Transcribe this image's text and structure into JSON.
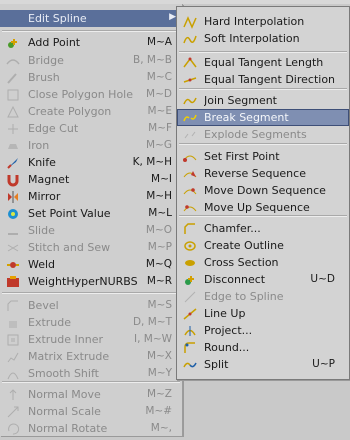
{
  "main_menu": {
    "header_label": "Edit Spline",
    "items": [
      {
        "label": "Add Point",
        "shortcut": "M~A",
        "icon": "add-point-icon",
        "enabled": true
      },
      {
        "label": "Bridge",
        "shortcut": "B, M~B",
        "icon": "bridge-icon",
        "enabled": false
      },
      {
        "label": "Brush",
        "shortcut": "M~C",
        "icon": "brush-icon",
        "enabled": false
      },
      {
        "label": "Close Polygon Hole",
        "shortcut": "M~D",
        "icon": "close-hole-icon",
        "enabled": false
      },
      {
        "label": "Create Polygon",
        "shortcut": "M~E",
        "icon": "create-polygon-icon",
        "enabled": false
      },
      {
        "label": "Edge Cut",
        "shortcut": "M~F",
        "icon": "edge-cut-icon",
        "enabled": false
      },
      {
        "label": "Iron",
        "shortcut": "M~G",
        "icon": "iron-icon",
        "enabled": false
      },
      {
        "label": "Knife",
        "shortcut": "K, M~H",
        "icon": "knife-icon",
        "enabled": true
      },
      {
        "label": "Magnet",
        "shortcut": "M~I",
        "icon": "magnet-icon",
        "enabled": true
      },
      {
        "label": "Mirror",
        "shortcut": "M~H",
        "icon": "mirror-icon",
        "enabled": true
      },
      {
        "label": "Set Point Value",
        "shortcut": "M~L",
        "icon": "set-point-value-icon",
        "enabled": true
      },
      {
        "label": "Slide",
        "shortcut": "M~O",
        "icon": "slide-icon",
        "enabled": false
      },
      {
        "label": "Stitch and Sew",
        "shortcut": "M~P",
        "icon": "stitch-icon",
        "enabled": false
      },
      {
        "label": "Weld",
        "shortcut": "M~Q",
        "icon": "weld-icon",
        "enabled": true
      },
      {
        "label": "WeightHyperNURBS",
        "shortcut": "M~R",
        "icon": "weight-hypernurbs-icon",
        "enabled": true
      },
      {
        "label": "Bevel",
        "shortcut": "M~S",
        "icon": "bevel-icon",
        "enabled": false
      },
      {
        "label": "Extrude",
        "shortcut": "D, M~T",
        "icon": "extrude-icon",
        "enabled": false
      },
      {
        "label": "Extrude Inner",
        "shortcut": "I, M~W",
        "icon": "extrude-inner-icon",
        "enabled": false
      },
      {
        "label": "Matrix Extrude",
        "shortcut": "M~X",
        "icon": "matrix-extrude-icon",
        "enabled": false
      },
      {
        "label": "Smooth Shift",
        "shortcut": "M~Y",
        "icon": "smooth-shift-icon",
        "enabled": false
      },
      {
        "label": "Normal Move",
        "shortcut": "M~Z",
        "icon": "normal-move-icon",
        "enabled": false
      },
      {
        "label": "Normal Scale",
        "shortcut": "M~#",
        "icon": "normal-scale-icon",
        "enabled": false
      },
      {
        "label": "Normal Rotate",
        "shortcut": "M~,",
        "icon": "normal-rotate-icon",
        "enabled": false
      }
    ]
  },
  "sub_menu": {
    "items": [
      {
        "label": "Hard Interpolation",
        "shortcut": "",
        "icon": "hard-interpolation-icon",
        "enabled": true
      },
      {
        "label": "Soft Interpolation",
        "shortcut": "",
        "icon": "soft-interpolation-icon",
        "enabled": true
      },
      {
        "label": "Equal Tangent Length",
        "shortcut": "",
        "icon": "equal-tangent-length-icon",
        "enabled": true
      },
      {
        "label": "Equal Tangent Direction",
        "shortcut": "",
        "icon": "equal-tangent-direction-icon",
        "enabled": true
      },
      {
        "label": "Join Segment",
        "shortcut": "",
        "icon": "join-segment-icon",
        "enabled": true
      },
      {
        "label": "Break Segment",
        "shortcut": "",
        "icon": "break-segment-icon",
        "enabled": true
      },
      {
        "label": "Explode Segments",
        "shortcut": "",
        "icon": "explode-segments-icon",
        "enabled": false
      },
      {
        "label": "Set First Point",
        "shortcut": "",
        "icon": "set-first-point-icon",
        "enabled": true
      },
      {
        "label": "Reverse Sequence",
        "shortcut": "",
        "icon": "reverse-sequence-icon",
        "enabled": true
      },
      {
        "label": "Move Down Sequence",
        "shortcut": "",
        "icon": "move-down-sequence-icon",
        "enabled": true
      },
      {
        "label": "Move Up Sequence",
        "shortcut": "",
        "icon": "move-up-sequence-icon",
        "enabled": true
      },
      {
        "label": "Chamfer...",
        "shortcut": "",
        "icon": "chamfer-icon",
        "enabled": true
      },
      {
        "label": "Create Outline",
        "shortcut": "",
        "icon": "create-outline-icon",
        "enabled": true
      },
      {
        "label": "Cross Section",
        "shortcut": "",
        "icon": "cross-section-icon",
        "enabled": true
      },
      {
        "label": "Disconnect",
        "shortcut": "U~D",
        "icon": "disconnect-icon",
        "enabled": true
      },
      {
        "label": "Edge to Spline",
        "shortcut": "",
        "icon": "edge-to-spline-icon",
        "enabled": false
      },
      {
        "label": "Line Up",
        "shortcut": "",
        "icon": "line-up-icon",
        "enabled": true
      },
      {
        "label": "Project...",
        "shortcut": "",
        "icon": "project-icon",
        "enabled": true
      },
      {
        "label": "Round...",
        "shortcut": "",
        "icon": "round-icon",
        "enabled": true
      },
      {
        "label": "Split",
        "shortcut": "U~P",
        "icon": "split-icon",
        "enabled": true
      }
    ]
  },
  "colors": {
    "menu_bg": "#cfcfcf",
    "highlight": "#5a6f9a",
    "active": "#7f8fb2",
    "disabled_text": "#8a8a8a"
  }
}
